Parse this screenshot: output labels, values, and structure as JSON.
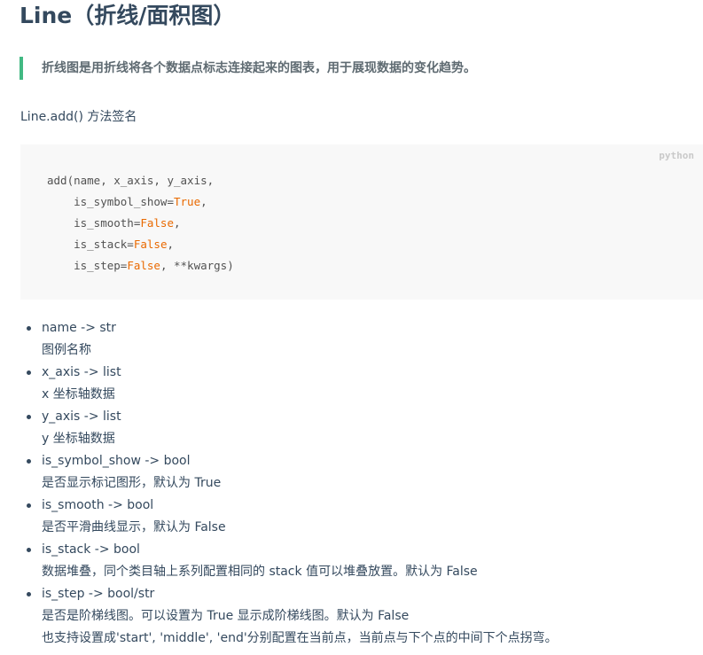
{
  "page": {
    "title": "Line（折线/面积图）",
    "quote": "折线图是用折线将各个数据点标志连接起来的图表，用于展现数据的变化趋势。",
    "intro": "Line.add() 方法签名"
  },
  "code": {
    "language": "python",
    "lines": [
      {
        "before": "add(name, x_axis, y_axis,",
        "keyword": "",
        "after": ""
      },
      {
        "before": "    is_symbol_show=",
        "keyword": "True",
        "after": ","
      },
      {
        "before": "    is_smooth=",
        "keyword": "False",
        "after": ","
      },
      {
        "before": "    is_stack=",
        "keyword": "False",
        "after": ","
      },
      {
        "before": "    is_step=",
        "keyword": "False",
        "after": ", **kwargs)"
      }
    ]
  },
  "params": [
    {
      "signature": "name -> str",
      "description": [
        "图例名称"
      ]
    },
    {
      "signature": "x_axis -> list",
      "description": [
        "x 坐标轴数据"
      ]
    },
    {
      "signature": "y_axis -> list",
      "description": [
        "y 坐标轴数据"
      ]
    },
    {
      "signature": "is_symbol_show -> bool",
      "description": [
        "是否显示标记图形，默认为 True"
      ]
    },
    {
      "signature": "is_smooth -> bool",
      "description": [
        "是否平滑曲线显示，默认为 False"
      ]
    },
    {
      "signature": "is_stack -> bool",
      "description": [
        "数据堆叠，同个类目轴上系列配置相同的 stack 值可以堆叠放置。默认为 False"
      ]
    },
    {
      "signature": "is_step -> bool/str",
      "description": [
        "是否是阶梯线图。可以设置为 True 显示成阶梯线图。默认为 False",
        "也支持设置成'start', 'middle', 'end'分别配置在当前点，当前点与下个点的中间下个点拐弯。"
      ]
    }
  ]
}
